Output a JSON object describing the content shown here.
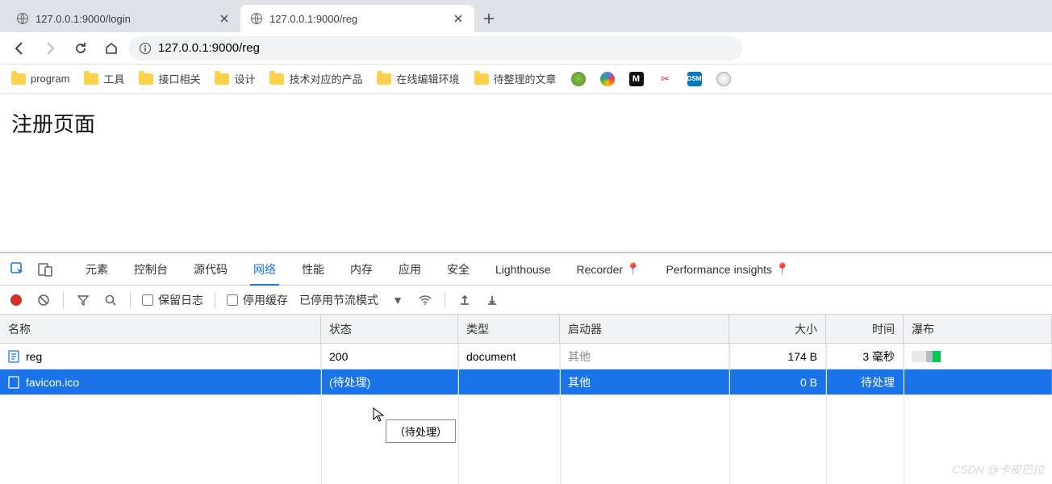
{
  "tabs": [
    {
      "title": "127.0.0.1:9000/login"
    },
    {
      "title": "127.0.0.1:9000/reg"
    }
  ],
  "url": "127.0.0.1:9000/reg",
  "bookmarks": [
    {
      "label": "program"
    },
    {
      "label": "工具"
    },
    {
      "label": "接口相关"
    },
    {
      "label": "设计"
    },
    {
      "label": "技术对应的产品"
    },
    {
      "label": "在线编辑环境"
    },
    {
      "label": "待整理的文章"
    }
  ],
  "page_heading": "注册页面",
  "devtools": {
    "tabs": [
      "元素",
      "控制台",
      "源代码",
      "网络",
      "性能",
      "内存",
      "应用",
      "安全",
      "Lighthouse",
      "Recorder",
      "Performance insights"
    ],
    "active_tab": "网络",
    "toolbar": {
      "preserve_log": "保留日志",
      "disable_cache": "停用缓存",
      "throttling": "已停用节流模式"
    },
    "columns": {
      "name": "名称",
      "status": "状态",
      "type": "类型",
      "initiator": "启动器",
      "size": "大小",
      "time": "时间",
      "waterfall": "瀑布"
    },
    "rows": [
      {
        "name": "reg",
        "status": "200",
        "type": "document",
        "initiator": "其他",
        "size": "174 B",
        "time": "3 毫秒",
        "icon": "doc",
        "selected": false,
        "waterfall": [
          {
            "color": "#e8e8e8",
            "w": 18
          },
          {
            "color": "#b0bec5",
            "w": 8
          },
          {
            "color": "#00c853",
            "w": 10
          }
        ]
      },
      {
        "name": "favicon.ico",
        "status": "(待处理)",
        "type": "",
        "initiator": "其他",
        "size": "0 B",
        "time": "待处理",
        "icon": "file",
        "selected": true,
        "waterfall": []
      }
    ],
    "tooltip": "（待处理）"
  },
  "watermark": "CSDN @卡皮巴拉"
}
